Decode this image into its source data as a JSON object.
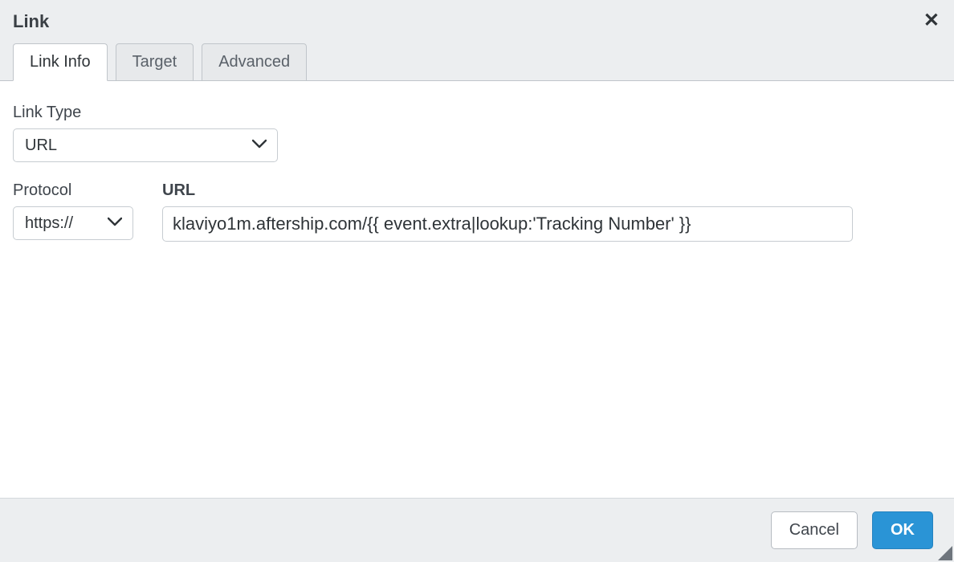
{
  "dialog": {
    "title": "Link",
    "tabs": [
      {
        "label": "Link Info",
        "active": true
      },
      {
        "label": "Target",
        "active": false
      },
      {
        "label": "Advanced",
        "active": false
      }
    ]
  },
  "form": {
    "link_type": {
      "label": "Link Type",
      "value": "URL"
    },
    "protocol": {
      "label": "Protocol",
      "value": "https://"
    },
    "url": {
      "label": "URL",
      "value": "klaviyo1m.aftership.com/{{ event.extra|lookup:'Tracking Number' }}"
    }
  },
  "footer": {
    "cancel_label": "Cancel",
    "ok_label": "OK"
  }
}
